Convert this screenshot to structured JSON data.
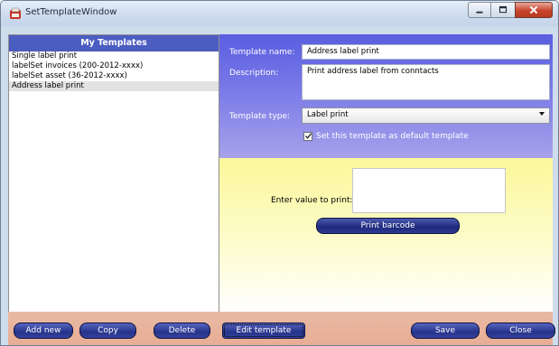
{
  "window": {
    "title": "SetTemplateWindow"
  },
  "templates": {
    "header": "My Templates",
    "items": [
      "Single label print",
      "labelSet invoices (200-2012-xxxx)",
      "labelSet asset (36-2012-xxxx)",
      "Address label print"
    ],
    "selected_index": 3
  },
  "form": {
    "name_label": "Template name:",
    "name_value": "Address label print",
    "description_label": "Description:",
    "description_value": "Print address label from conntacts",
    "type_label": "Template type:",
    "type_value": "Label print",
    "default_checkbox_label": "Set this template as default template",
    "default_checked": true
  },
  "print": {
    "value_label": "Enter value to print:",
    "value": "",
    "button_label": "Print barcode"
  },
  "buttons": {
    "add_new": "Add new",
    "copy": "Copy",
    "delete": "Delete",
    "edit_template": "Edit template",
    "save": "Save",
    "close": "Close"
  },
  "colors": {
    "header_bg": "#4b5dc1",
    "form_gradient_top": "#5a5ee0",
    "print_area_top": "#fbf79a",
    "bottom_bar": "#e9b9a4",
    "button_dark": "#26338a"
  },
  "icons": {
    "app": "app-icon",
    "minimize": "minimize-icon",
    "maximize": "maximize-icon",
    "close": "close-icon",
    "dropdown": "chevron-down-icon",
    "check": "check-icon"
  }
}
